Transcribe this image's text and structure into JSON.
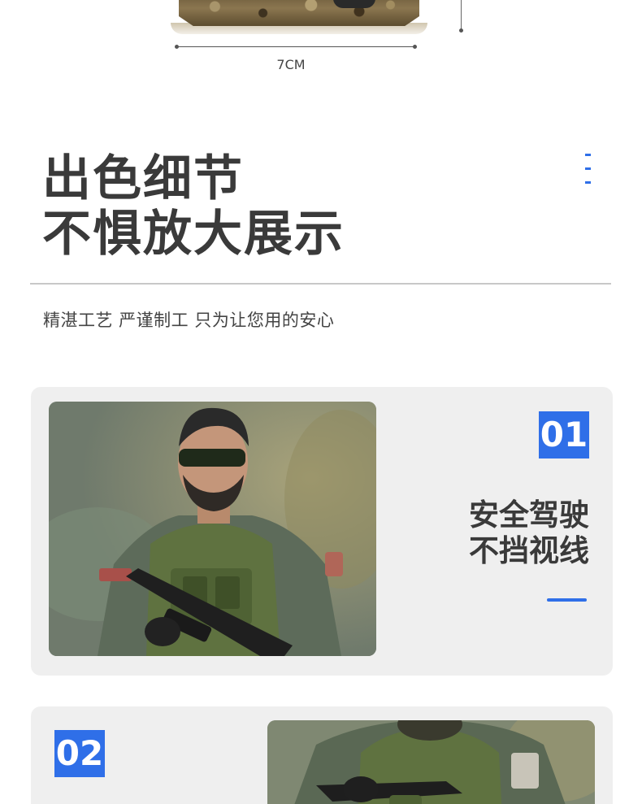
{
  "dimension": {
    "label": "7CM"
  },
  "heading": {
    "line1": "出色细节",
    "line2": "不惧放大展示"
  },
  "subtitle": "精湛工艺 严谨制工 只为让您用的安心",
  "cards": [
    {
      "number": "01",
      "title_line1": "安全驾驶",
      "title_line2": "不挡视线"
    },
    {
      "number": "02"
    }
  ],
  "colors": {
    "accent": "#2f6fe8",
    "heading": "#3a3a3a",
    "card_bg": "#efefef"
  },
  "icons": [
    "base-illustration",
    "soldier-figure-photo"
  ]
}
